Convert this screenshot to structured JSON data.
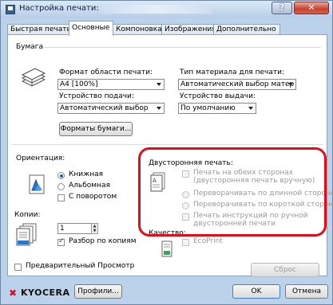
{
  "window": {
    "title": "Настройка печати:",
    "help_label": "?",
    "close_label": "✕"
  },
  "tabs": [
    {
      "label": "Быстрая печать"
    },
    {
      "label": "Основные"
    },
    {
      "label": "Компоновка"
    },
    {
      "label": "Изображения"
    },
    {
      "label": "Дополнительно"
    }
  ],
  "paper": {
    "group_label": "Бумага",
    "size_label": "Формат области печати:",
    "size_value": "A4  [100%]",
    "source_label": "Устройство подачи:",
    "source_value": "Автоматический выбор",
    "media_label": "Тип материала для печати:",
    "media_value": "Автоматический выбор матер",
    "output_label": "Устройство выдачи:",
    "output_value": "По умолчанию",
    "formats_button": "Форматы бумаги..."
  },
  "orientation": {
    "label": "Ориентация:",
    "portrait": "Книжная",
    "landscape": "Альбомная",
    "rotated": "С поворотом"
  },
  "copies": {
    "label": "Копии:",
    "value": "1",
    "collate": "Разбор по копиям"
  },
  "duplex": {
    "label": "Двусторонняя печать:",
    "both_sides": "Печать на обеих сторонах (двусторонняя печать вручную)",
    "flip_long": "Переворачивать по длинной стороне",
    "flip_short": "Переворачивать по короткой стороне",
    "instructions": "Печать инструкций по ручной двусторонней печати"
  },
  "quality": {
    "label": "Качество:",
    "ecoprint": "EcoPrint"
  },
  "preview_label": "Предварительный Просмотр",
  "reset_button": "Сброс",
  "bottom": {
    "logo_text": "KYOCERA",
    "profiles_button": "Профили...",
    "ok_button": "OK",
    "cancel_button": "Отмена"
  },
  "accent_color": "#e20d18"
}
